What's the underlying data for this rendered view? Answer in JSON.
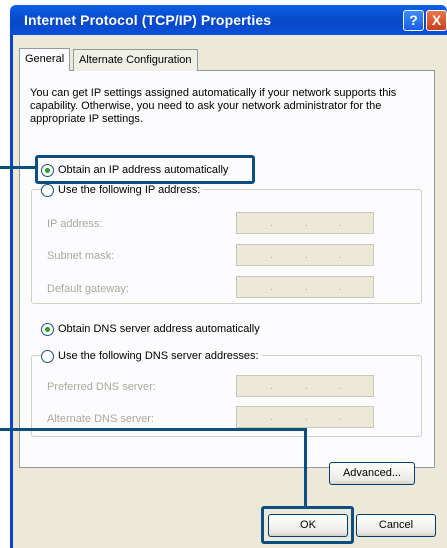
{
  "window": {
    "title": "Internet Protocol (TCP/IP) Properties",
    "help_glyph": "?",
    "close_glyph": "X"
  },
  "tabs": [
    {
      "label": "General",
      "selected": true
    },
    {
      "label": "Alternate Configuration",
      "selected": false
    }
  ],
  "intro": "You can get IP settings assigned automatically if your network supports this capability. Otherwise, you need to ask your network administrator for the appropriate IP settings.",
  "ip": {
    "auto_label": "Obtain an IP address automatically",
    "auto_selected": true,
    "manual_label": "Use the following IP address:",
    "fields": [
      {
        "label": "IP address:"
      },
      {
        "label": "Subnet mask:"
      },
      {
        "label": "Default gateway:"
      }
    ]
  },
  "dns": {
    "auto_label": "Obtain DNS server address automatically",
    "auto_selected": true,
    "manual_label": "Use the following DNS server addresses:",
    "fields": [
      {
        "label": "Preferred DNS server:"
      },
      {
        "label": "Alternate DNS server:"
      }
    ]
  },
  "buttons": {
    "advanced": "Advanced...",
    "ok": "OK",
    "cancel": "Cancel"
  },
  "colors": {
    "titlebar": "#0848c8",
    "dialog_bg": "#ece9d8",
    "highlight": "#0b4f80",
    "radio_dot": "#21a121"
  }
}
